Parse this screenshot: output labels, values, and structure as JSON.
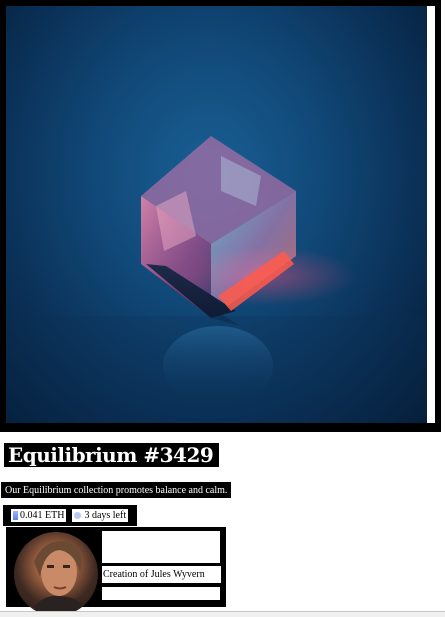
{
  "nft": {
    "image_alt": "Glowing glass cube on blue background",
    "title": "Equilibrium #3429",
    "description": "Our Equilibrium collection promotes balance and calm.",
    "price": "0.041 ETH",
    "time_left": "3 days left",
    "creator_text": "Creation of Jules Wyvern"
  },
  "icons": {
    "price": "ethereum-icon",
    "time": "clock-icon"
  },
  "colors": {
    "background": "#ffffff",
    "frame": "#000000",
    "image_blue": "#114a7a",
    "eth_blue": "#627eea"
  }
}
